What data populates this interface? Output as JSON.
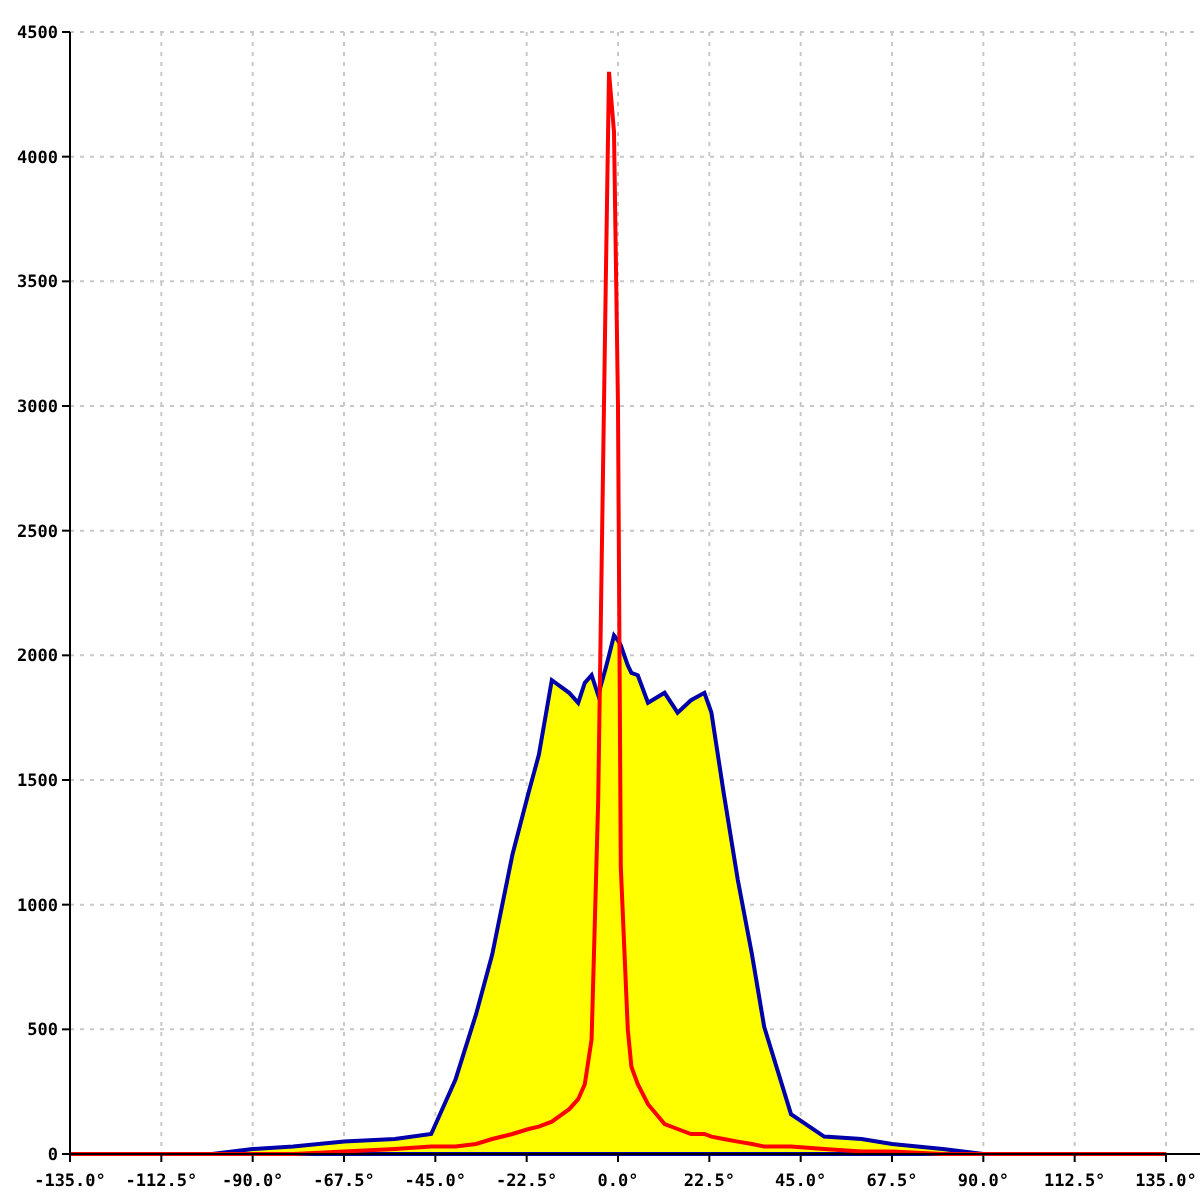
{
  "chart_data": {
    "type": "area",
    "grid": true,
    "x": [
      -135,
      -100,
      -90,
      -80,
      -67.5,
      -55,
      -46,
      -40,
      -35,
      -31,
      -26,
      -22,
      -19.5,
      -16.3,
      -12,
      -9.8,
      -8.2,
      -6.5,
      -4.9,
      -3,
      -2.2,
      -1,
      0,
      0.7,
      2.4,
      3.3,
      4.9,
      7.4,
      11.5,
      14.7,
      18,
      21.3,
      23,
      26,
      29.5,
      33,
      36,
      42.6,
      50.8,
      60,
      67.5,
      80,
      90,
      135
    ],
    "series": [
      {
        "type": "area",
        "color": "#ffff00",
        "values": [
          null,
          0,
          20,
          30,
          50,
          60,
          80,
          300,
          560,
          800,
          1200,
          1450,
          1600,
          1900,
          1850,
          1810,
          1890,
          1920,
          1840,
          1950,
          2000,
          2080,
          2060,
          2040,
          1960,
          1930,
          1920,
          1810,
          1850,
          1770,
          1820,
          1850,
          1770,
          1450,
          1100,
          800,
          510,
          160,
          70,
          60,
          40,
          20,
          0,
          null
        ]
      },
      {
        "type": "line",
        "color": "#ff0000",
        "values": [
          0,
          0,
          0,
          0,
          10,
          20,
          30,
          30,
          40,
          60,
          80,
          100,
          110,
          130,
          180,
          220,
          280,
          460,
          1420,
          3500,
          4340,
          4100,
          3000,
          1150,
          500,
          350,
          280,
          200,
          120,
          100,
          80,
          80,
          70,
          60,
          50,
          40,
          30,
          30,
          20,
          10,
          10,
          0,
          0,
          0
        ]
      }
    ],
    "xlim": [
      -135,
      135
    ],
    "ylim": [
      0,
      4500
    ],
    "xticks": [
      {
        "value": -135,
        "label": "-135.0°"
      },
      {
        "value": -112.5,
        "label": "-112.5°"
      },
      {
        "value": -90,
        "label": "-90.0°"
      },
      {
        "value": -67.5,
        "label": "-67.5°"
      },
      {
        "value": -45,
        "label": "-45.0°"
      },
      {
        "value": -22.5,
        "label": "-22.5°"
      },
      {
        "value": 0,
        "label": "0.0°"
      },
      {
        "value": 22.5,
        "label": "22.5°"
      },
      {
        "value": 45,
        "label": "45.0°"
      },
      {
        "value": 67.5,
        "label": "67.5°"
      },
      {
        "value": 90,
        "label": "90.0°"
      },
      {
        "value": 112.5,
        "label": "112.5°"
      },
      {
        "value": 135,
        "label": "135.0°"
      }
    ],
    "yticks": [
      0,
      500,
      1000,
      1500,
      2000,
      2500,
      3000,
      3500,
      4000,
      4500
    ]
  }
}
